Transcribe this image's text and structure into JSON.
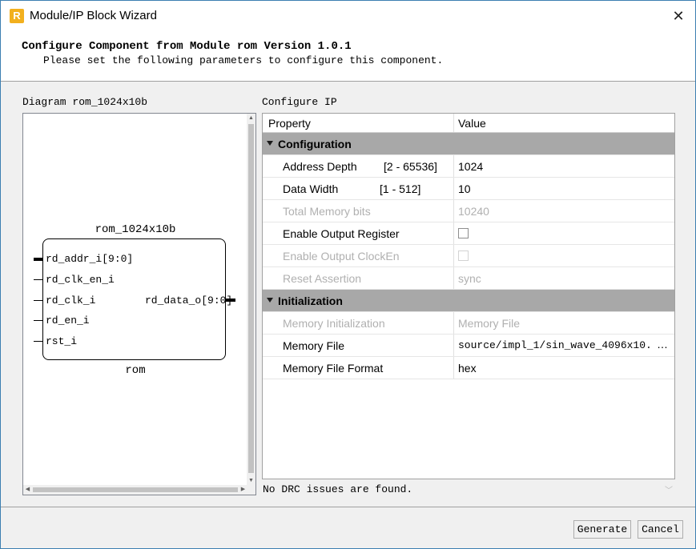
{
  "window": {
    "title": "Module/IP Block Wizard",
    "icon": "r-logo-icon",
    "accent": "#f2b01e"
  },
  "header": {
    "title": "Configure Component from Module rom Version 1.0.1",
    "subtitle": "Please set the following parameters to configure this component."
  },
  "diagram": {
    "label": "Diagram rom_1024x10b",
    "block_title": "rom_1024x10b",
    "block_name": "rom",
    "inputs": [
      "rd_addr_i[9:0]",
      "rd_clk_en_i",
      "rd_clk_i",
      "rd_en_i",
      "rst_i"
    ],
    "outputs": [
      "rd_data_o[9:0]"
    ]
  },
  "config": {
    "label": "Configure IP",
    "headers": {
      "property": "Property",
      "value": "Value"
    },
    "groups": [
      {
        "name": "Configuration",
        "rows": [
          {
            "property": "Address Depth",
            "range": "[2 - 65536]",
            "value": "1024"
          },
          {
            "property": "Data Width",
            "range": "[1 - 512]",
            "value": "10"
          },
          {
            "property": "Total Memory bits",
            "value": "10240"
          },
          {
            "property": "Enable Output Register"
          },
          {
            "property": "Enable Output ClockEn"
          },
          {
            "property": "Reset Assertion",
            "value": "sync"
          }
        ]
      },
      {
        "name": "Initialization",
        "rows": [
          {
            "property": "Memory Initialization",
            "value": "Memory File"
          },
          {
            "property": "Memory File",
            "value": "source/impl_1/sin_wave_4096x10.",
            "action": "…"
          },
          {
            "property": "Memory File Format",
            "value": "hex"
          }
        ]
      }
    ]
  },
  "status": {
    "drc": "No DRC issues are found."
  },
  "buttons": {
    "generate": "Generate",
    "cancel": "Cancel"
  }
}
